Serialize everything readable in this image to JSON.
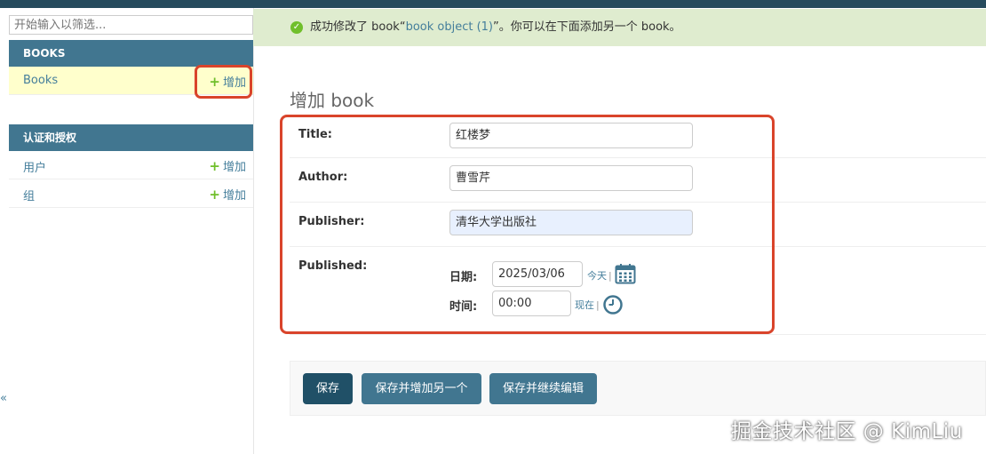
{
  "sidebar": {
    "filter_placeholder": "开始输入以筛选...",
    "modules": [
      {
        "header": "BOOKS",
        "rows": [
          {
            "label": "Books",
            "add": "增加",
            "active": true
          }
        ]
      },
      {
        "header": "认证和授权",
        "rows": [
          {
            "label": "用户",
            "add": "增加"
          },
          {
            "label": "组",
            "add": "增加"
          }
        ]
      }
    ],
    "edge_text": "«"
  },
  "message": {
    "prefix": "成功修改了 book“",
    "link": "book object (1)",
    "suffix": "”。你可以在下面添加另一个 book。"
  },
  "page": {
    "title": "增加 book"
  },
  "form": {
    "title": {
      "label": "Title:",
      "value": "红楼梦"
    },
    "author": {
      "label": "Author:",
      "value": "曹雪芹"
    },
    "publisher": {
      "label": "Publisher:",
      "value": "清华大学出版社"
    },
    "published": {
      "label": "Published:",
      "date_label": "日期:",
      "date_value": "2025/03/06",
      "date_shortcut": "今天",
      "time_label": "时间:",
      "time_value": "00:00",
      "time_shortcut": "现在",
      "separator": "|"
    }
  },
  "buttons": {
    "save": "保存",
    "save_add_another": "保存并增加另一个",
    "save_continue": "保存并继续编辑"
  },
  "watermark": "掘金技术社区 @ KimLiu",
  "colors": {
    "header_bar": "#264b5d",
    "module_header": "#417690",
    "link": "#447e9b",
    "success_bg": "#dfeccf",
    "add_plus": "#70bf2b",
    "highlight_box": "#d9442b"
  }
}
